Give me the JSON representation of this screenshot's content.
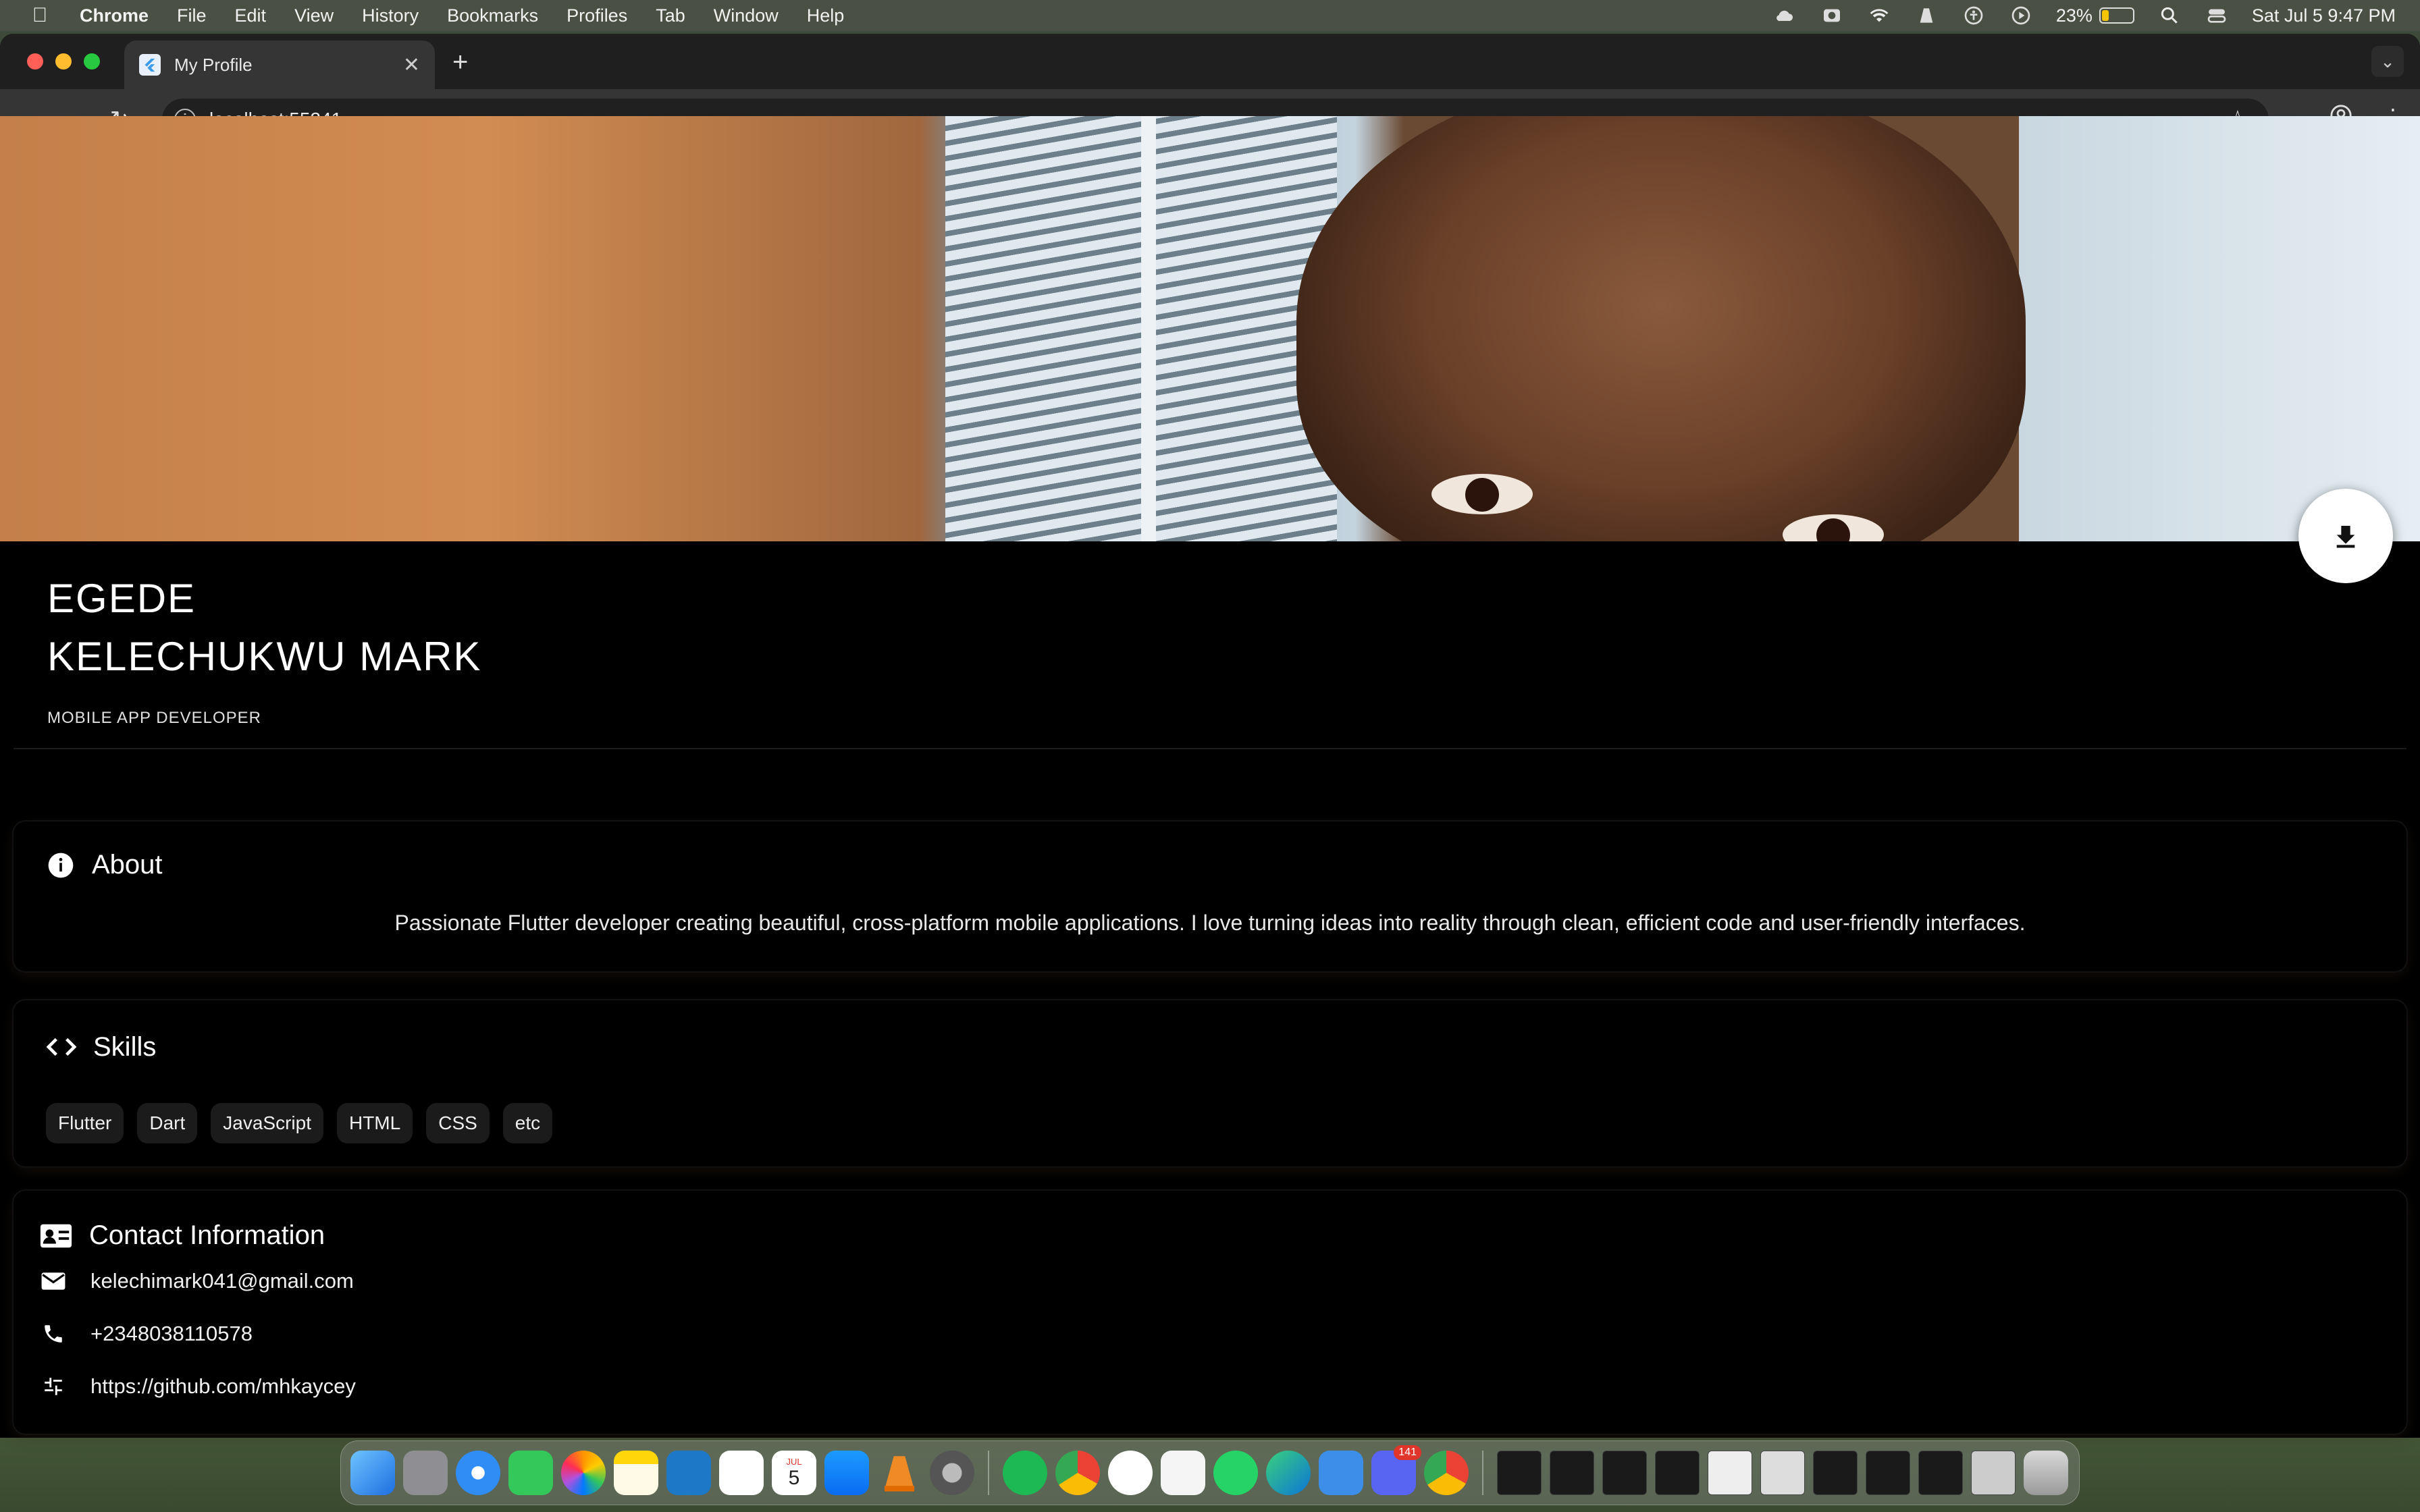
{
  "menubar": {
    "app_name": "Chrome",
    "menus": [
      "File",
      "Edit",
      "View",
      "History",
      "Bookmarks",
      "Profiles",
      "Tab",
      "Window",
      "Help"
    ],
    "battery_percent": "23%",
    "battery_level": 0.23,
    "datetime": "Sat Jul 5  9:47 PM",
    "status_icons": [
      "cloud-icon",
      "camera-icon",
      "wifi-icon",
      "vlc-icon",
      "accessibility-icon",
      "play-icon",
      "battery-icon",
      "search-icon",
      "control-center-icon"
    ]
  },
  "browser": {
    "tab_title": "My Profile",
    "url": "localhost:55241",
    "new_tab_label": "+"
  },
  "profile": {
    "name_line1": "EGEDE",
    "name_line2": "KELECHUKWU MARK",
    "role": "MOBILE APP DEVELOPER"
  },
  "about": {
    "title": "About",
    "icon": "info-icon",
    "text": "Passionate Flutter developer creating beautiful, cross-platform mobile applications. I love turning ideas into reality through clean, efficient code and user-friendly interfaces."
  },
  "skills": {
    "title": "Skills",
    "icon": "code-icon",
    "items": [
      "Flutter",
      "Dart",
      "JavaScript",
      "HTML",
      "CSS",
      "etc"
    ]
  },
  "contact": {
    "title": "Contact Information",
    "icon": "contact-card-icon",
    "email": "kelechimark041@gmail.com",
    "phone": "+2348038110578",
    "github": "https://github.com/mhkaycey"
  },
  "dock": {
    "discord_badge": "141",
    "calendar_month": "JUL",
    "calendar_day": "5"
  },
  "colors": {
    "page_bg": "#000000",
    "chip_bg": "#1b1b1b",
    "fab_bg": "#ffffff"
  }
}
